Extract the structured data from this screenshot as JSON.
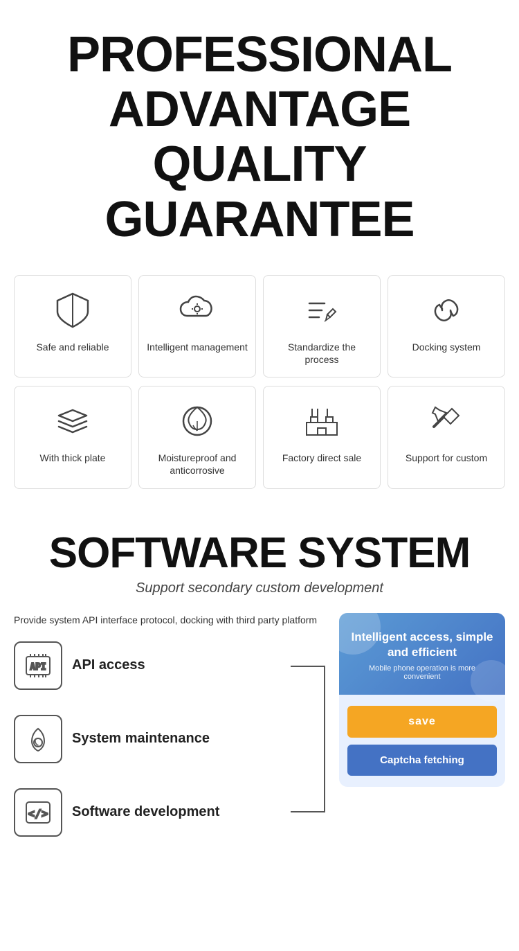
{
  "header": {
    "line1": "PROFESSIONAL",
    "line2": "ADVANTAGE",
    "line3": "QUALITY GUARANTEE"
  },
  "features_row1": [
    {
      "id": "safe-reliable",
      "label": "Safe and reliable",
      "icon": "shield"
    },
    {
      "id": "intelligent-management",
      "label": "Intelligent management",
      "icon": "cloud-settings"
    },
    {
      "id": "standardize-process",
      "label": "Standardize the process",
      "icon": "pencil-lines"
    },
    {
      "id": "docking-system",
      "label": "Docking system",
      "icon": "link"
    }
  ],
  "features_row2": [
    {
      "id": "thick-plate",
      "label": "With thick plate",
      "icon": "layers"
    },
    {
      "id": "moistureproof",
      "label": "Moistureproof and anticorrosive",
      "icon": "leaf-drop"
    },
    {
      "id": "factory-direct",
      "label": "Factory direct sale",
      "icon": "factory"
    },
    {
      "id": "support-custom",
      "label": "Support for custom",
      "icon": "tools"
    }
  ],
  "software": {
    "title": "SOFTWARE SYSTEM",
    "subtitle": "Support secondary custom development",
    "description": "Provide system API interface protocol, docking with third party platform",
    "items": [
      {
        "id": "api-access",
        "label": "API access",
        "icon": "api"
      },
      {
        "id": "system-maintenance",
        "label": "System maintenance",
        "icon": "maintenance"
      },
      {
        "id": "software-development",
        "label": "Software development",
        "icon": "code"
      }
    ],
    "phone": {
      "main_text": "Intelligent access, simple and efficient",
      "sub_text": "Mobile phone operation is more convenient",
      "btn_save": "save",
      "btn_captcha": "Captcha fetching"
    }
  }
}
